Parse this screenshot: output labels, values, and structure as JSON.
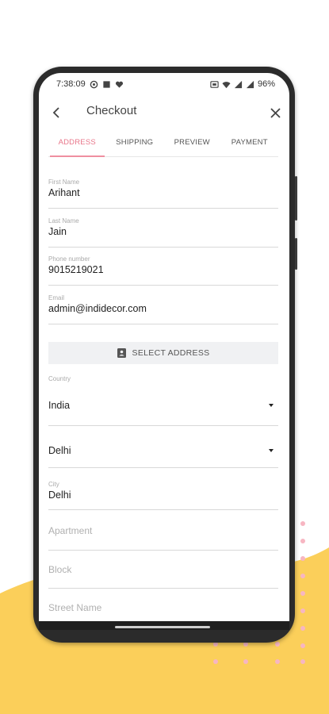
{
  "colors": {
    "accent": "#e8768a",
    "backdrop_yellow": "#fbcf5a",
    "dots_pink": "#f7b6c2"
  },
  "status_bar": {
    "time": "7:38:09",
    "left_icons": [
      "circle-status-icon",
      "square-status-icon",
      "heart-status-icon"
    ],
    "right_icons": [
      "nfc-icon",
      "wifi-icon",
      "signal-icon",
      "signal-icon"
    ],
    "battery": "96%"
  },
  "header": {
    "title": "Checkout",
    "back_icon": "arrow-left-icon",
    "close_icon": "close-icon"
  },
  "tabs": [
    {
      "label": "ADDRESS",
      "active": true
    },
    {
      "label": "SHIPPING",
      "active": false
    },
    {
      "label": "PREVIEW",
      "active": false
    },
    {
      "label": "PAYMENT",
      "active": false
    }
  ],
  "form": {
    "first_name": {
      "label": "First Name",
      "value": "Arihant"
    },
    "last_name": {
      "label": "Last Name",
      "value": "Jain"
    },
    "phone": {
      "label": "Phone number",
      "value": "9015219021"
    },
    "email": {
      "label": "Email",
      "value": "admin@indidecor.com"
    },
    "select_address": {
      "label": "SELECT ADDRESS",
      "icon": "contact-card-icon"
    },
    "country": {
      "label": "Country",
      "value": "India"
    },
    "state": {
      "value": "Delhi"
    },
    "city": {
      "label": "City",
      "value": "Delhi"
    },
    "apartment": {
      "placeholder": "Apartment"
    },
    "block": {
      "placeholder": "Block"
    },
    "street": {
      "placeholder": "Street Name"
    }
  }
}
